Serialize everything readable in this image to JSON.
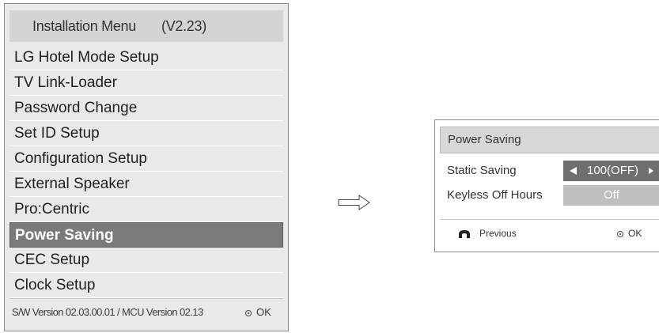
{
  "install_menu": {
    "title": "Installation Menu",
    "version": "(V2.23)",
    "items": [
      {
        "label": "LG Hotel Mode Setup",
        "selected": false
      },
      {
        "label": "TV Link-Loader",
        "selected": false
      },
      {
        "label": "Password Change",
        "selected": false
      },
      {
        "label": "Set ID Setup",
        "selected": false
      },
      {
        "label": "Configuration Setup",
        "selected": false
      },
      {
        "label": "External Speaker",
        "selected": false
      },
      {
        "label": "Pro:Centric",
        "selected": false
      },
      {
        "label": "Power Saving",
        "selected": true
      },
      {
        "label": "CEC Setup",
        "selected": false
      },
      {
        "label": "Clock Setup",
        "selected": false
      }
    ],
    "footer_version": "S/W Version 02.03.00.01 / MCU Version 02.13",
    "ok_label": "OK"
  },
  "arrow": {
    "icon": "right-arrow-icon"
  },
  "power_saving": {
    "title": "Power Saving",
    "static_saving": {
      "label": "Static Saving",
      "value": "100(OFF)"
    },
    "keyless_off": {
      "label": "Keyless Off Hours",
      "value": "Off"
    },
    "previous_label": "Previous",
    "ok_label": "OK"
  },
  "colors": {
    "panel_bg": "#e9e9e9",
    "header_bg": "#d4d4d4",
    "selected_bg": "#7a7a7a",
    "value_bg_active": "#6f6f6f",
    "value_bg_inactive": "#bfbfbf"
  }
}
